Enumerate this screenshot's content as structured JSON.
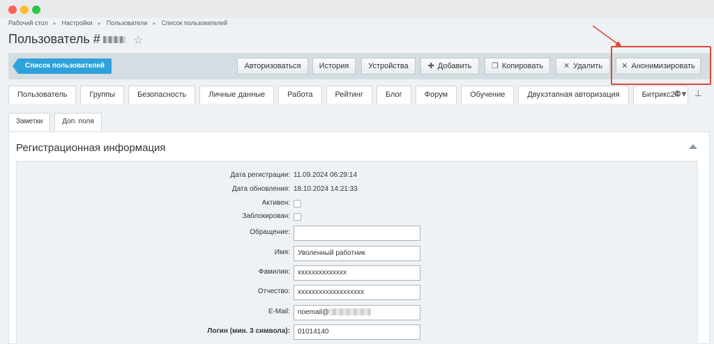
{
  "breadcrumb": [
    "Рабочий стол",
    "Настройки",
    "Пользователи",
    "Список пользователей"
  ],
  "page_title": "Пользователь #",
  "toolbar": {
    "back_label": "Список пользователей",
    "buttons": [
      {
        "label": "Авторизоваться",
        "icon": ""
      },
      {
        "label": "История",
        "icon": ""
      },
      {
        "label": "Устройства",
        "icon": ""
      },
      {
        "label": "Добавить",
        "icon": "+"
      },
      {
        "label": "Копировать",
        "icon": "copy-icon"
      },
      {
        "label": "Удалить",
        "icon": "✕"
      },
      {
        "label": "Анонимизировать",
        "icon": "✕"
      }
    ]
  },
  "tabs": [
    "Пользователь",
    "Группы",
    "Безопасность",
    "Личные данные",
    "Работа",
    "Рейтинг",
    "Блог",
    "Форум",
    "Обучение",
    "Двухэтапная авторизация",
    "Битрикс24"
  ],
  "subtabs": [
    "Заметки",
    "Доп. поля"
  ],
  "panel": {
    "title": "Регистрационная информация",
    "rows": {
      "reg_date_label": "Дата регистрации:",
      "reg_date": "11.09.2024 06:29:14",
      "upd_date_label": "Дата обновления:",
      "upd_date": "18.10.2024 14:21:33",
      "active_label": "Активен:",
      "blocked_label": "Заблокирован:",
      "title_label": "Обращение:",
      "title_value": "",
      "name_label": "Имя:",
      "name_value": "Уволенный работник",
      "lastname_label": "Фамилия:",
      "lastname_value": "xxxxxxxxxxxxxx",
      "secondname_label": "Отчество:",
      "secondname_value": "xxxxxxxxxxxxxxxxxxx",
      "email_label": "E-Mail:",
      "email_value": "noemail@",
      "login_label": "Логин (мин. 3 символа):",
      "login_value": "01014140"
    }
  },
  "colors": {
    "accent": "#2fa1dc",
    "highlight": "#e0453c",
    "toolbar_bg": "#d4dde2",
    "page_bg": "#eef2f4"
  }
}
